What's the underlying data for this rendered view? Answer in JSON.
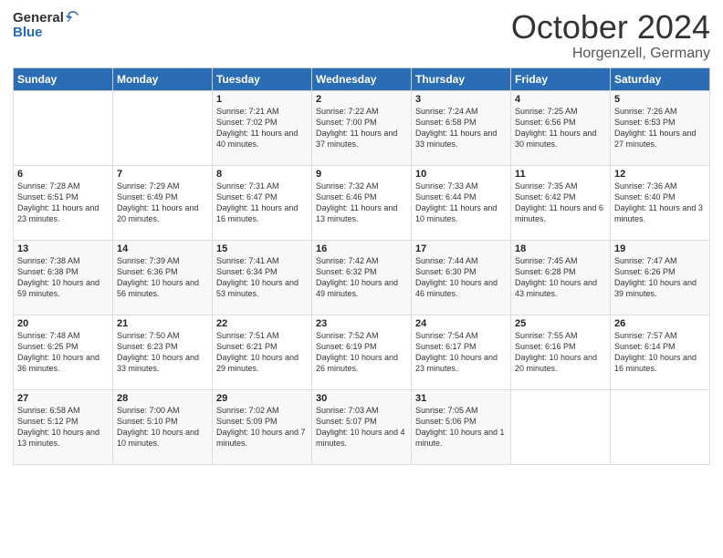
{
  "logo": {
    "general": "General",
    "blue": "Blue"
  },
  "header": {
    "month": "October 2024",
    "location": "Horgenzell, Germany"
  },
  "weekdays": [
    "Sunday",
    "Monday",
    "Tuesday",
    "Wednesday",
    "Thursday",
    "Friday",
    "Saturday"
  ],
  "weeks": [
    [
      {
        "day": "",
        "sunrise": "",
        "sunset": "",
        "daylight": ""
      },
      {
        "day": "",
        "sunrise": "",
        "sunset": "",
        "daylight": ""
      },
      {
        "day": "1",
        "sunrise": "Sunrise: 7:21 AM",
        "sunset": "Sunset: 7:02 PM",
        "daylight": "Daylight: 11 hours and 40 minutes."
      },
      {
        "day": "2",
        "sunrise": "Sunrise: 7:22 AM",
        "sunset": "Sunset: 7:00 PM",
        "daylight": "Daylight: 11 hours and 37 minutes."
      },
      {
        "day": "3",
        "sunrise": "Sunrise: 7:24 AM",
        "sunset": "Sunset: 6:58 PM",
        "daylight": "Daylight: 11 hours and 33 minutes."
      },
      {
        "day": "4",
        "sunrise": "Sunrise: 7:25 AM",
        "sunset": "Sunset: 6:56 PM",
        "daylight": "Daylight: 11 hours and 30 minutes."
      },
      {
        "day": "5",
        "sunrise": "Sunrise: 7:26 AM",
        "sunset": "Sunset: 6:53 PM",
        "daylight": "Daylight: 11 hours and 27 minutes."
      }
    ],
    [
      {
        "day": "6",
        "sunrise": "Sunrise: 7:28 AM",
        "sunset": "Sunset: 6:51 PM",
        "daylight": "Daylight: 11 hours and 23 minutes."
      },
      {
        "day": "7",
        "sunrise": "Sunrise: 7:29 AM",
        "sunset": "Sunset: 6:49 PM",
        "daylight": "Daylight: 11 hours and 20 minutes."
      },
      {
        "day": "8",
        "sunrise": "Sunrise: 7:31 AM",
        "sunset": "Sunset: 6:47 PM",
        "daylight": "Daylight: 11 hours and 16 minutes."
      },
      {
        "day": "9",
        "sunrise": "Sunrise: 7:32 AM",
        "sunset": "Sunset: 6:46 PM",
        "daylight": "Daylight: 11 hours and 13 minutes."
      },
      {
        "day": "10",
        "sunrise": "Sunrise: 7:33 AM",
        "sunset": "Sunset: 6:44 PM",
        "daylight": "Daylight: 11 hours and 10 minutes."
      },
      {
        "day": "11",
        "sunrise": "Sunrise: 7:35 AM",
        "sunset": "Sunset: 6:42 PM",
        "daylight": "Daylight: 11 hours and 6 minutes."
      },
      {
        "day": "12",
        "sunrise": "Sunrise: 7:36 AM",
        "sunset": "Sunset: 6:40 PM",
        "daylight": "Daylight: 11 hours and 3 minutes."
      }
    ],
    [
      {
        "day": "13",
        "sunrise": "Sunrise: 7:38 AM",
        "sunset": "Sunset: 6:38 PM",
        "daylight": "Daylight: 10 hours and 59 minutes."
      },
      {
        "day": "14",
        "sunrise": "Sunrise: 7:39 AM",
        "sunset": "Sunset: 6:36 PM",
        "daylight": "Daylight: 10 hours and 56 minutes."
      },
      {
        "day": "15",
        "sunrise": "Sunrise: 7:41 AM",
        "sunset": "Sunset: 6:34 PM",
        "daylight": "Daylight: 10 hours and 53 minutes."
      },
      {
        "day": "16",
        "sunrise": "Sunrise: 7:42 AM",
        "sunset": "Sunset: 6:32 PM",
        "daylight": "Daylight: 10 hours and 49 minutes."
      },
      {
        "day": "17",
        "sunrise": "Sunrise: 7:44 AM",
        "sunset": "Sunset: 6:30 PM",
        "daylight": "Daylight: 10 hours and 46 minutes."
      },
      {
        "day": "18",
        "sunrise": "Sunrise: 7:45 AM",
        "sunset": "Sunset: 6:28 PM",
        "daylight": "Daylight: 10 hours and 43 minutes."
      },
      {
        "day": "19",
        "sunrise": "Sunrise: 7:47 AM",
        "sunset": "Sunset: 6:26 PM",
        "daylight": "Daylight: 10 hours and 39 minutes."
      }
    ],
    [
      {
        "day": "20",
        "sunrise": "Sunrise: 7:48 AM",
        "sunset": "Sunset: 6:25 PM",
        "daylight": "Daylight: 10 hours and 36 minutes."
      },
      {
        "day": "21",
        "sunrise": "Sunrise: 7:50 AM",
        "sunset": "Sunset: 6:23 PM",
        "daylight": "Daylight: 10 hours and 33 minutes."
      },
      {
        "day": "22",
        "sunrise": "Sunrise: 7:51 AM",
        "sunset": "Sunset: 6:21 PM",
        "daylight": "Daylight: 10 hours and 29 minutes."
      },
      {
        "day": "23",
        "sunrise": "Sunrise: 7:52 AM",
        "sunset": "Sunset: 6:19 PM",
        "daylight": "Daylight: 10 hours and 26 minutes."
      },
      {
        "day": "24",
        "sunrise": "Sunrise: 7:54 AM",
        "sunset": "Sunset: 6:17 PM",
        "daylight": "Daylight: 10 hours and 23 minutes."
      },
      {
        "day": "25",
        "sunrise": "Sunrise: 7:55 AM",
        "sunset": "Sunset: 6:16 PM",
        "daylight": "Daylight: 10 hours and 20 minutes."
      },
      {
        "day": "26",
        "sunrise": "Sunrise: 7:57 AM",
        "sunset": "Sunset: 6:14 PM",
        "daylight": "Daylight: 10 hours and 16 minutes."
      }
    ],
    [
      {
        "day": "27",
        "sunrise": "Sunrise: 6:58 AM",
        "sunset": "Sunset: 5:12 PM",
        "daylight": "Daylight: 10 hours and 13 minutes."
      },
      {
        "day": "28",
        "sunrise": "Sunrise: 7:00 AM",
        "sunset": "Sunset: 5:10 PM",
        "daylight": "Daylight: 10 hours and 10 minutes."
      },
      {
        "day": "29",
        "sunrise": "Sunrise: 7:02 AM",
        "sunset": "Sunset: 5:09 PM",
        "daylight": "Daylight: 10 hours and 7 minutes."
      },
      {
        "day": "30",
        "sunrise": "Sunrise: 7:03 AM",
        "sunset": "Sunset: 5:07 PM",
        "daylight": "Daylight: 10 hours and 4 minutes."
      },
      {
        "day": "31",
        "sunrise": "Sunrise: 7:05 AM",
        "sunset": "Sunset: 5:06 PM",
        "daylight": "Daylight: 10 hours and 1 minute."
      },
      {
        "day": "",
        "sunrise": "",
        "sunset": "",
        "daylight": ""
      },
      {
        "day": "",
        "sunrise": "",
        "sunset": "",
        "daylight": ""
      }
    ]
  ]
}
